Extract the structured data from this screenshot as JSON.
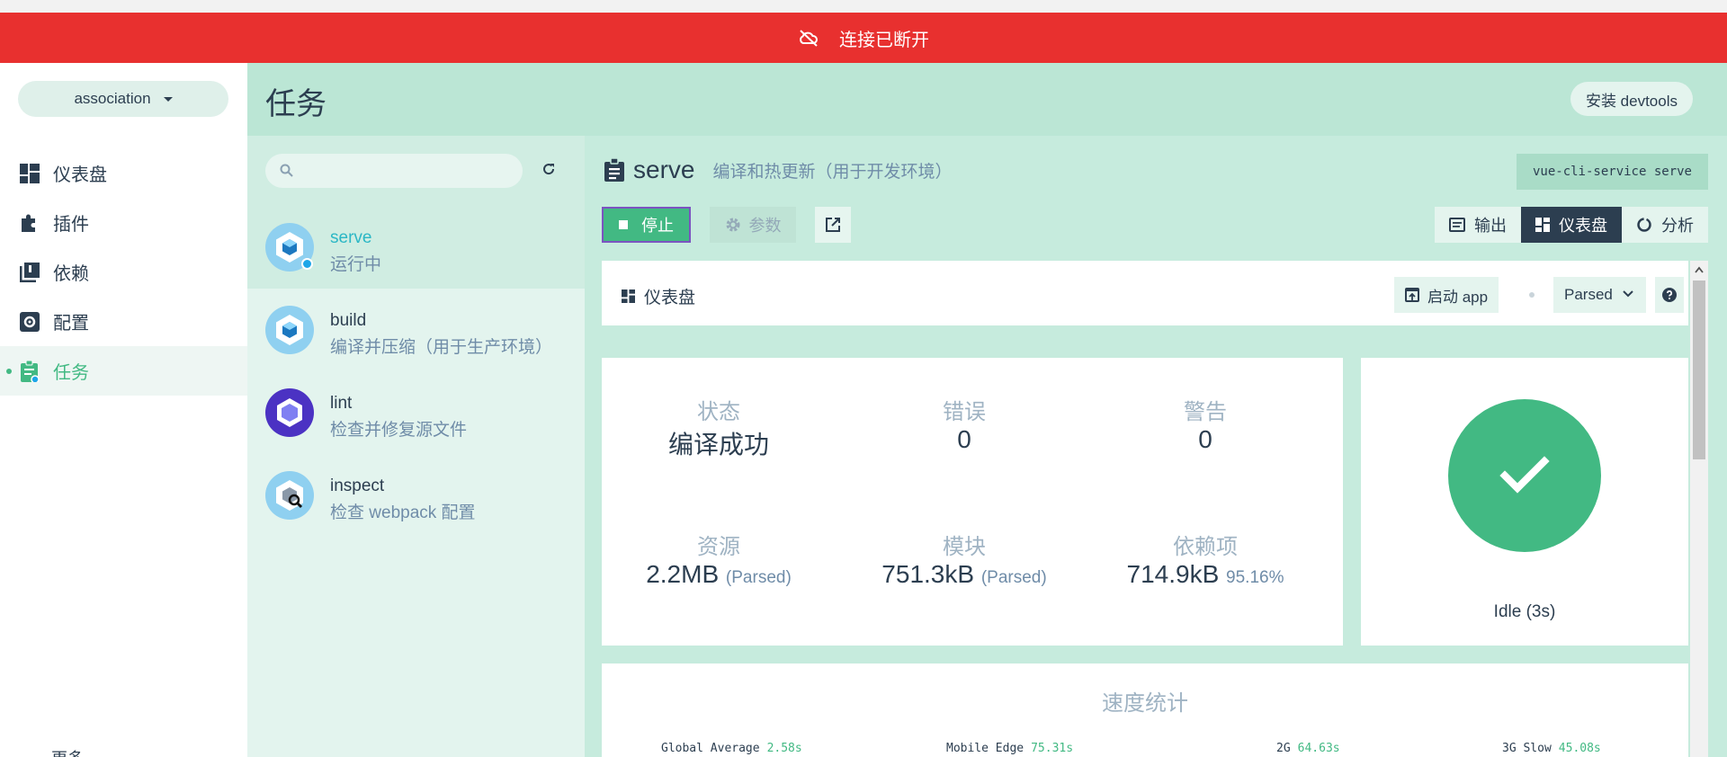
{
  "banner": {
    "text": "连接已断开"
  },
  "sidebar": {
    "project": "association",
    "nav": [
      {
        "label": "仪表盘"
      },
      {
        "label": "插件"
      },
      {
        "label": "依赖"
      },
      {
        "label": "配置"
      },
      {
        "label": "任务"
      }
    ],
    "active_index": 4,
    "more_label": "更多"
  },
  "header": {
    "title": "任务",
    "devtools_label": "安装 devtools"
  },
  "tasks": [
    {
      "name": "serve",
      "desc": "运行中",
      "icon": "webpack-cube-icon",
      "selected": true
    },
    {
      "name": "build",
      "desc": "编译并压缩（用于生产环境）",
      "icon": "webpack-cube-icon"
    },
    {
      "name": "lint",
      "desc": "检查并修复源文件",
      "icon": "eslint-hexagon-icon"
    },
    {
      "name": "inspect",
      "desc": "检查 webpack 配置",
      "icon": "webpack-inspect-icon"
    }
  ],
  "task_detail": {
    "name": "serve",
    "description": "编译和热更新（用于开发环境）",
    "command": "vue-cli-service serve",
    "stop_label": "停止",
    "params_label": "参数",
    "tabs": [
      {
        "label": "输出",
        "icon": "terminal-icon"
      },
      {
        "label": "仪表盘",
        "icon": "dashboard-icon",
        "active": true
      },
      {
        "label": "分析",
        "icon": "donut-chart-icon"
      }
    ]
  },
  "dashboard": {
    "label": "仪表盘",
    "launch_label": "启动 app",
    "size_mode": "Parsed",
    "stats": {
      "status": {
        "label": "状态",
        "value": "编译成功"
      },
      "errors": {
        "label": "错误",
        "value": "0"
      },
      "warnings": {
        "label": "警告",
        "value": "0"
      },
      "assets": {
        "label": "资源",
        "value": "2.2MB",
        "note": "(Parsed)"
      },
      "modules": {
        "label": "模块",
        "value": "751.3kB",
        "note": "(Parsed)"
      },
      "deps": {
        "label": "依赖项",
        "value": "714.9kB",
        "note": "95.16%"
      }
    },
    "status_text": "Idle (3s)"
  },
  "speed": {
    "title": "速度统计",
    "items": [
      {
        "name": "Global Average",
        "value": "2.58s"
      },
      {
        "name": "Mobile Edge",
        "value": "75.31s"
      },
      {
        "name": "2G",
        "value": "64.63s"
      },
      {
        "name": "3G Slow",
        "value": "45.08s"
      }
    ]
  },
  "colors": {
    "accent": "#42b983",
    "danger": "#e8302f",
    "dark": "#2c3e50"
  }
}
